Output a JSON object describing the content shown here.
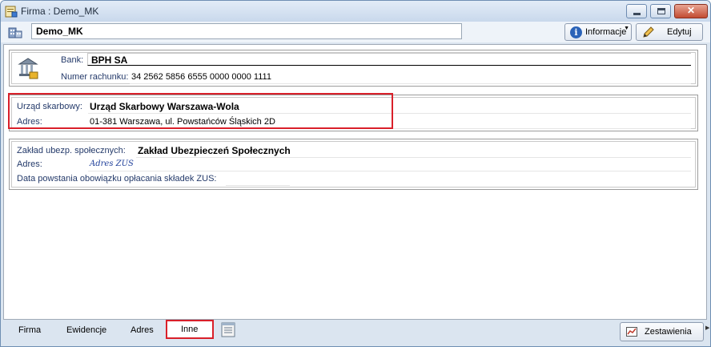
{
  "window": {
    "title": "Firma : Demo_MK",
    "minimize": "",
    "maximize": "",
    "close": "✕"
  },
  "toolbar": {
    "company_name": "Demo_MK",
    "info_label": "Informacje",
    "edit_label": "Edytuj"
  },
  "bank_panel": {
    "bank_label": "Bank:",
    "bank_value": "BPH SA",
    "account_label": "Numer rachunku:",
    "account_value": "34 2562 5856 6555 0000 0000 1111"
  },
  "tax_panel": {
    "office_label": "Urząd skarbowy:",
    "office_value": "Urząd Skarbowy Warszawa-Wola",
    "address_label": "Adres:",
    "address_value": "01-381 Warszawa, ul. Powstańców Śląskich 2D"
  },
  "zus_panel": {
    "zus_label": "Zakład ubezp. społecznych:",
    "zus_value": "Zakład Ubezpieczeń Społecznych",
    "address_label": "Adres:",
    "address_value": "Adres ZUS",
    "date_label": "Data powstania obowiązku opłacania składek ZUS:",
    "date_value": ""
  },
  "bottom_tabs": [
    {
      "label": "Firma"
    },
    {
      "label": "Ewidencje"
    },
    {
      "label": "Adres"
    },
    {
      "label": "Inne"
    }
  ],
  "bottom": {
    "reports_label": "Zestawienia"
  },
  "colors": {
    "highlight": "#d9202a",
    "label_text": "#243a6a"
  }
}
